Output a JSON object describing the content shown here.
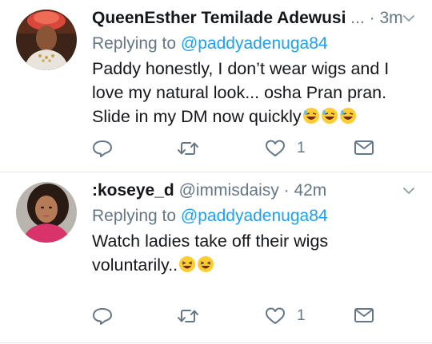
{
  "tweets": [
    {
      "name": "QueenEsther Temilade Adewusi",
      "ellipsis": "...",
      "dot": "·",
      "time": "3m",
      "reply_prefix": "Replying to ",
      "reply_mention": "@paddyadenuga84",
      "text_lines": [
        "Paddy honestly, I don’t wear wigs and I",
        "love my natural look... osha Pran pran.",
        "Slide in my DM now quickly"
      ],
      "text_emoji": [
        "rolling-on-floor-laughing",
        "rolling-on-floor-laughing",
        "rolling-on-floor-laughing"
      ],
      "like_count": "1"
    },
    {
      "name": ":koseye_d",
      "handle": "@immisdaisy",
      "dot": "·",
      "time": "42m",
      "reply_prefix": "Replying to ",
      "reply_mention": "@paddyadenuga84",
      "text_lines": [
        "Watch ladies take off their wigs",
        "voluntarily.."
      ],
      "text_emoji": [
        "grinning-squinting-face",
        "grinning-squinting-face"
      ],
      "like_count": "1"
    }
  ],
  "colors": {
    "text": "#14171a",
    "secondary": "#657786",
    "link": "#1da1f2",
    "divider": "#e1e8ed"
  },
  "icons": [
    "reply-icon",
    "retweet-icon",
    "heart-icon",
    "mail-icon",
    "chevron-down-icon"
  ]
}
